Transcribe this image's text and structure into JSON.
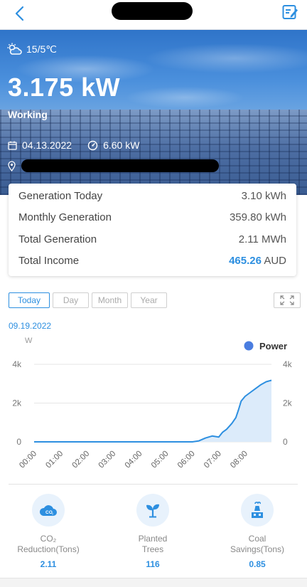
{
  "nav": {
    "back_icon": "chevron-left-icon",
    "edit_icon": "edit-note-icon"
  },
  "hero": {
    "weather_icon": "cloud-sun-icon",
    "temperature": "15/5℃",
    "power": "3.175 kW",
    "status": "Working",
    "date": "04.13.2022",
    "capacity": "6.60 kW"
  },
  "summary": {
    "rows": [
      {
        "label": "Generation Today",
        "value": "3.10 kWh"
      },
      {
        "label": "Monthly Generation",
        "value": "359.80 kWh"
      },
      {
        "label": "Total Generation",
        "value": "2.11 MWh"
      }
    ],
    "income_label": "Total Income",
    "income_value": "465.26",
    "income_unit": "AUD"
  },
  "tabs": [
    "Today",
    "Day",
    "Month",
    "Year"
  ],
  "active_tab": "Today",
  "chart_date": "09.19.2022",
  "chart_data": {
    "type": "area",
    "unit_label": "W",
    "legend": "Power",
    "legend_position": "top-right",
    "x_ticks": [
      "00:00",
      "01:00",
      "02:00",
      "03:00",
      "04:00",
      "05:00",
      "06:00",
      "07:00",
      "08:00"
    ],
    "y_ticks": [
      "0",
      "2k",
      "4k"
    ],
    "ylim": [
      0,
      4000
    ],
    "xlim_hours": [
      0,
      9
    ],
    "series": [
      {
        "name": "Power",
        "color": "#2d8fe0",
        "fill": "#dcebfa",
        "x_hours": [
          0,
          6.0,
          6.25,
          6.5,
          6.75,
          7.0,
          7.15,
          7.3,
          7.5,
          7.65,
          7.75,
          7.85,
          8.0,
          8.2,
          8.4,
          8.6,
          8.8,
          9.0
        ],
        "values": [
          0,
          0,
          50,
          200,
          300,
          250,
          500,
          650,
          950,
          1250,
          1650,
          2100,
          2350,
          2550,
          2750,
          2950,
          3100,
          3175
        ]
      }
    ]
  },
  "stats": [
    {
      "icon": "co2-cloud-icon",
      "label_line1": "CO₂",
      "label_line2": "Reduction(Tons)",
      "value": "2.11"
    },
    {
      "icon": "sprout-icon",
      "label_line1": "Planted",
      "label_line2": "Trees",
      "value": "116"
    },
    {
      "icon": "factory-icon",
      "label_line1": "Coal",
      "label_line2": "Savings(Tons)",
      "value": "0.85"
    }
  ],
  "colors": {
    "accent": "#2d8fe0",
    "chart_fill": "#dcebfa"
  }
}
